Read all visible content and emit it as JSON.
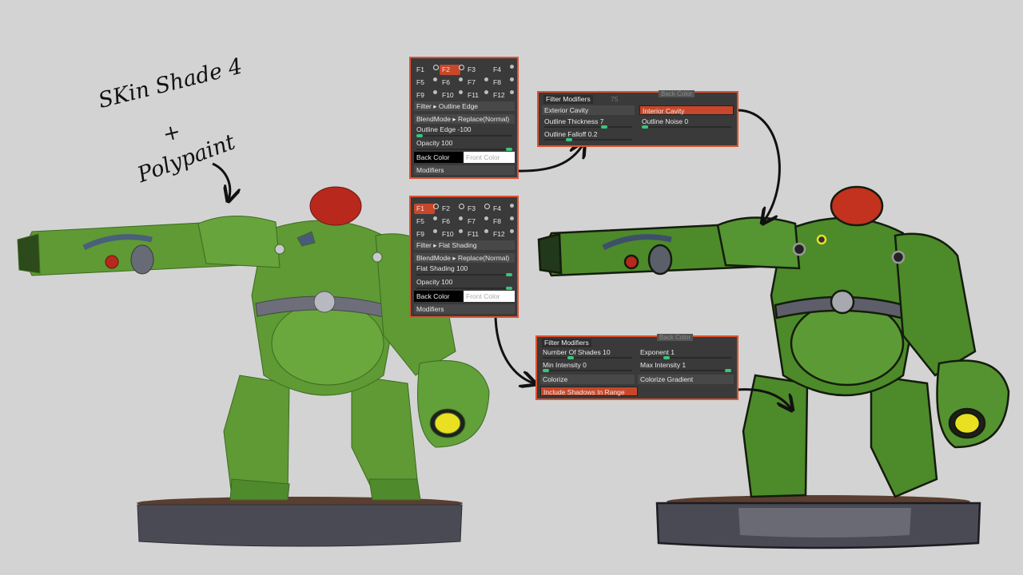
{
  "annotation": {
    "line1": "SKin Shade 4",
    "plus": "+",
    "line3": "Polypaint"
  },
  "top_panel": {
    "fkeys": [
      "F1",
      "F2",
      "F3",
      "F4",
      "F5",
      "F6",
      "F7",
      "F8",
      "F9",
      "F10",
      "F11",
      "F12"
    ],
    "active_fkey": "F2",
    "filter": "Filter ▸ Outline Edge",
    "blendmode": "BlendMode ▸ Replace(Normal)",
    "slider1_label": "Outline Edge -100",
    "slider1_level": 0.0,
    "slider2_label": "Opacity 100",
    "slider2_level": 1.0,
    "back_color": "Back Color",
    "front_color": "Front Color",
    "modifiers": "Modifiers"
  },
  "bottom_panel": {
    "fkeys": [
      "F1",
      "F2",
      "F3",
      "F4",
      "F5",
      "F6",
      "F7",
      "F8",
      "F9",
      "F10",
      "F11",
      "F12"
    ],
    "active_fkey": "F1",
    "filter": "Filter ▸ Flat Shading",
    "blendmode": "BlendMode ▸ Replace(Normal)",
    "slider1_label": "Flat Shading 100",
    "slider1_level": 1.0,
    "slider2_label": "Opacity 100",
    "slider2_level": 1.0,
    "back_color": "Back Color",
    "front_color": "Front Color",
    "modifiers": "Modifiers"
  },
  "outline_modifiers": {
    "title": "Filter Modifiers",
    "ghost_value": "75",
    "ghost_back_color": "Back Color",
    "exterior_cavity": "Exterior Cavity",
    "interior_cavity": "Interior Cavity",
    "outline_thickness": "Outline Thickness 7",
    "outline_noise": "Outline Noise 0",
    "outline_falloff": "Outline Falloff 0.2"
  },
  "flat_modifiers": {
    "title": "Filter Modifiers",
    "ghost_back_color": "Back Color",
    "number_of_shades": "Number Of Shades 10",
    "exponent": "Exponent 1",
    "min_intensity": "Min Intensity 0",
    "max_intensity": "Max Intensity 1",
    "colorize": "Colorize",
    "colorize_gradient": "Colorize Gradient",
    "include_shadows": "Include Shadows In Range"
  },
  "colors": {
    "background": "#d3d3d3",
    "accent_orange": "#e0512d",
    "panel_dark": "#3a3a3a",
    "slider_green": "#37c77a",
    "robot_green": "#5f9a35",
    "robot_green_toon": "#4d8a2a",
    "helmet_red": "#b8281c",
    "base_gray": "#4a4a55"
  }
}
